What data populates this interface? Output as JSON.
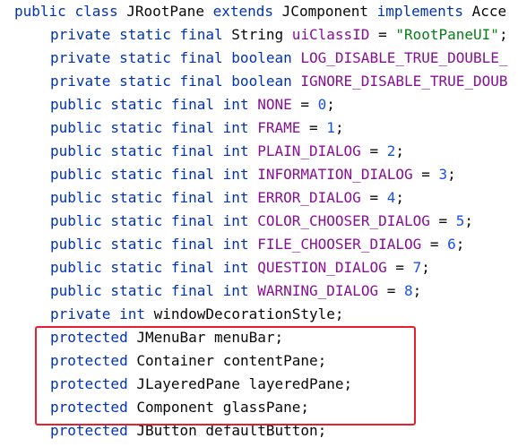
{
  "code": {
    "class_decl": {
      "kw_public": "public",
      "kw_class": "class",
      "class_name": "JRootPane",
      "kw_extends": "extends",
      "super_name": "JComponent",
      "kw_implements": "implements",
      "rest": "Acce"
    },
    "lines": [
      {
        "mods": "private static final",
        "type": "String",
        "type_is_kw": false,
        "name": "uiClassID",
        "op": " = ",
        "value": "\"RootPaneUI\"",
        "value_kind": "str",
        "end": ";"
      },
      {
        "mods": "private static final",
        "type": "boolean",
        "type_is_kw": true,
        "name": "LOG_DISABLE_TRUE_DOUBLE_",
        "op": "",
        "value": "",
        "value_kind": "",
        "end": ""
      },
      {
        "mods": "private static final",
        "type": "boolean",
        "type_is_kw": true,
        "name": "IGNORE_DISABLE_TRUE_DOUB",
        "op": "",
        "value": "",
        "value_kind": "",
        "end": ""
      },
      {
        "mods": "public static final",
        "type": "int",
        "type_is_kw": true,
        "name": "NONE",
        "op": " = ",
        "value": "0",
        "value_kind": "num",
        "end": ";"
      },
      {
        "mods": "public static final",
        "type": "int",
        "type_is_kw": true,
        "name": "FRAME",
        "op": " = ",
        "value": "1",
        "value_kind": "num",
        "end": ";"
      },
      {
        "mods": "public static final",
        "type": "int",
        "type_is_kw": true,
        "name": "PLAIN_DIALOG",
        "op": " = ",
        "value": "2",
        "value_kind": "num",
        "end": ";"
      },
      {
        "mods": "public static final",
        "type": "int",
        "type_is_kw": true,
        "name": "INFORMATION_DIALOG",
        "op": " = ",
        "value": "3",
        "value_kind": "num",
        "end": ";"
      },
      {
        "mods": "public static final",
        "type": "int",
        "type_is_kw": true,
        "name": "ERROR_DIALOG",
        "op": " = ",
        "value": "4",
        "value_kind": "num",
        "end": ";"
      },
      {
        "mods": "public static final",
        "type": "int",
        "type_is_kw": true,
        "name": "COLOR_CHOOSER_DIALOG",
        "op": " = ",
        "value": "5",
        "value_kind": "num",
        "end": ";"
      },
      {
        "mods": "public static final",
        "type": "int",
        "type_is_kw": true,
        "name": "FILE_CHOOSER_DIALOG",
        "op": " = ",
        "value": "6",
        "value_kind": "num",
        "end": ";"
      },
      {
        "mods": "public static final",
        "type": "int",
        "type_is_kw": true,
        "name": "QUESTION_DIALOG",
        "op": " = ",
        "value": "7",
        "value_kind": "num",
        "end": ";"
      },
      {
        "mods": "public static final",
        "type": "int",
        "type_is_kw": true,
        "name": "WARNING_DIALOG",
        "op": " = ",
        "value": "8",
        "value_kind": "num",
        "end": ";"
      },
      {
        "mods": "private",
        "type": "int",
        "type_is_kw": true,
        "name": "windowDecorationStyle",
        "op": "",
        "value": "",
        "value_kind": "",
        "end": ";"
      },
      {
        "mods": "protected",
        "type": "JMenuBar",
        "type_is_kw": false,
        "name": "menuBar",
        "op": "",
        "value": "",
        "value_kind": "",
        "end": ";"
      },
      {
        "mods": "protected",
        "type": "Container",
        "type_is_kw": false,
        "name": "contentPane",
        "op": "",
        "value": "",
        "value_kind": "",
        "end": ";"
      },
      {
        "mods": "protected",
        "type": "JLayeredPane",
        "type_is_kw": false,
        "name": "layeredPane",
        "op": "",
        "value": "",
        "value_kind": "",
        "end": ";"
      },
      {
        "mods": "protected",
        "type": "Component",
        "type_is_kw": false,
        "name": "glassPane",
        "op": "",
        "value": "",
        "value_kind": "",
        "end": ";"
      },
      {
        "mods": "protected",
        "type": "JButton",
        "type_is_kw": false,
        "name": "defaultButton",
        "op": "",
        "value": "",
        "value_kind": "",
        "end": ";"
      }
    ]
  },
  "colors": {
    "keyword": "#0033b3",
    "field": "#871094",
    "string": "#067d17",
    "number": "#1750eb",
    "highlight_border": "#e61e2d"
  }
}
